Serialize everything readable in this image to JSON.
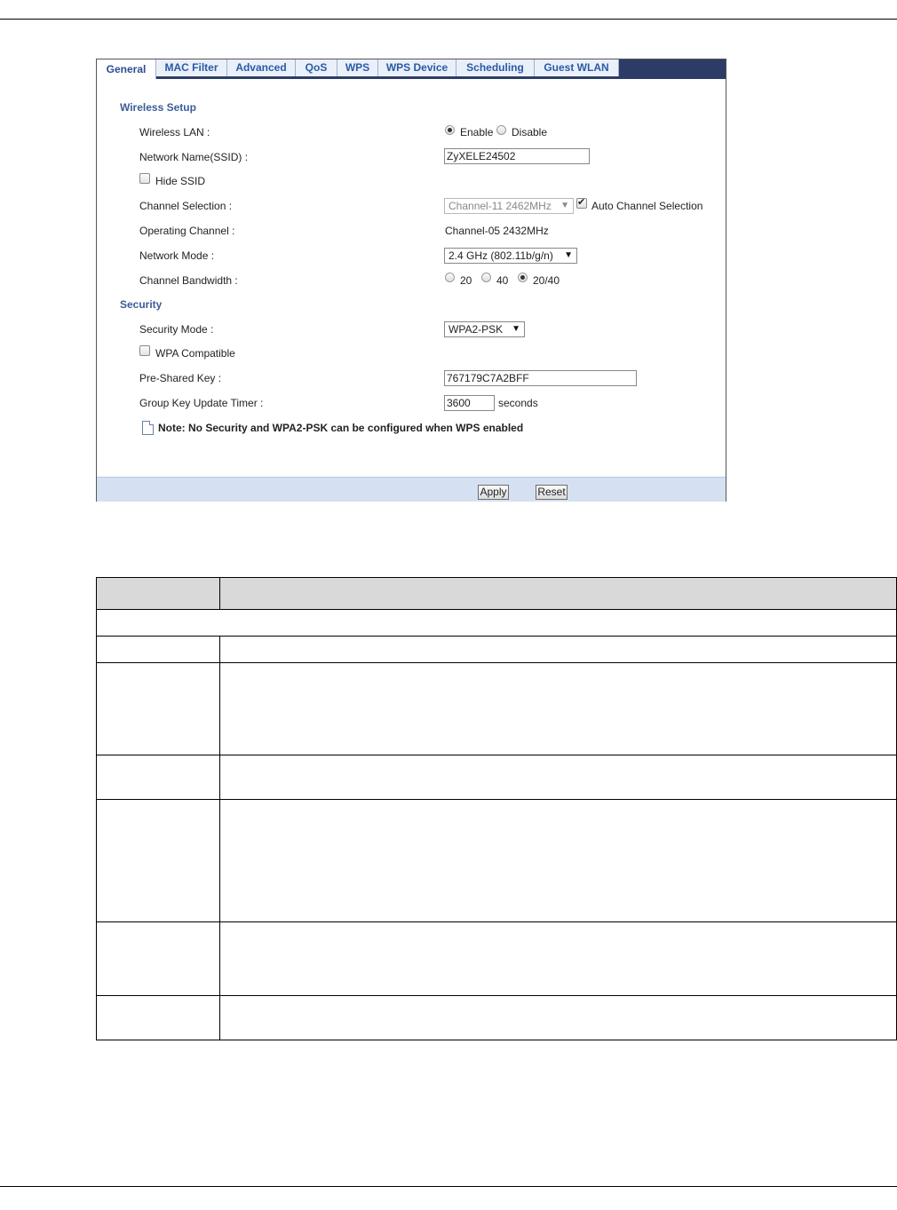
{
  "tabs": [
    {
      "label": "General"
    },
    {
      "label": "MAC Filter"
    },
    {
      "label": "Advanced"
    },
    {
      "label": "QoS"
    },
    {
      "label": "WPS"
    },
    {
      "label": "WPS Device"
    },
    {
      "label": "Scheduling"
    },
    {
      "label": "Guest WLAN"
    }
  ],
  "wireless_setup": {
    "title": "Wireless Setup",
    "wireless_lan_label": "Wireless LAN :",
    "enable_label": "Enable",
    "disable_label": "Disable",
    "enabled": true,
    "ssid_label": "Network Name(SSID) :",
    "ssid_value": "ZyXELE24502",
    "hide_ssid_label": "Hide SSID",
    "hide_ssid_checked": false,
    "channel_selection_label": "Channel Selection :",
    "channel_selection_value": "Channel-11 2462MHz",
    "auto_channel_label": "Auto Channel Selection",
    "auto_channel_checked": true,
    "operating_channel_label": "Operating Channel :",
    "operating_channel_value": "Channel-05 2432MHz",
    "network_mode_label": "Network Mode :",
    "network_mode_value": "2.4 GHz (802.11b/g/n)",
    "channel_bandwidth_label": "Channel Bandwidth :",
    "bandwidth_options": [
      "20",
      "40",
      "20/40"
    ],
    "bandwidth_selected": "20/40"
  },
  "security": {
    "title": "Security",
    "security_mode_label": "Security Mode :",
    "security_mode_value": "WPA2-PSK",
    "wpa_compatible_label": "WPA Compatible",
    "wpa_compatible_checked": false,
    "psk_label": "Pre-Shared Key :",
    "psk_value": "767179C7A2BFF",
    "group_key_label": "Group Key Update Timer :",
    "group_key_value": "3600",
    "group_key_unit": "seconds",
    "note": "Note: No Security and WPA2-PSK can be configured when WPS enabled"
  },
  "buttons": {
    "apply": "Apply",
    "reset": "Reset"
  },
  "colors": {
    "tabbar_background": "#2d3c66",
    "section_title": "#3b5c9a",
    "footer_bar": "#d5e1f2",
    "table_header": "#d9d9d9"
  }
}
